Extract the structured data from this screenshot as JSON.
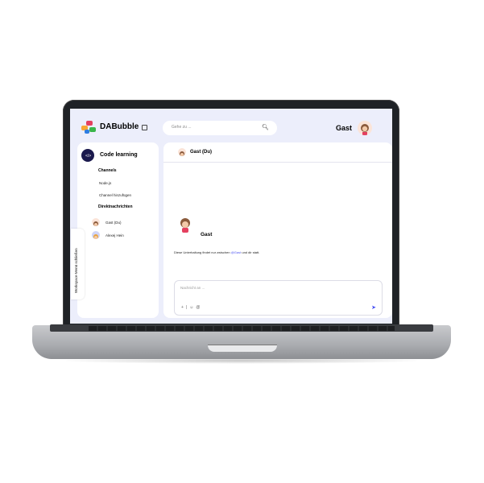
{
  "app": {
    "brand": "DABubble",
    "search_placeholder": "Gehe zu ...",
    "user_name": "Gast"
  },
  "sidebar": {
    "workspace_title": "Code learning",
    "channels_heading": "Channels",
    "channels": [
      "Node.js",
      "Channel hinzufügen"
    ],
    "dm_heading": "Direktnachrichten",
    "dms": [
      "Gast (Du)",
      "Alexej Hein"
    ],
    "toggle_label": "Workspace-Menü schließen"
  },
  "chat": {
    "title": "Gast (Du)",
    "profile_name": "Gast",
    "intro_before": "Diese Unterhaltung findet nur zwischen ",
    "intro_mention": "@Gast",
    "intro_after": " und dir statt.",
    "composer_placeholder": "Nachricht an ..."
  },
  "icons": {
    "logo": "dabubble-logo",
    "workspace": "workspace-edit-icon",
    "search": "search-icon",
    "send": "send-icon",
    "composer_tools": [
      "add-icon",
      "emoji-icon",
      "mention-icon"
    ]
  },
  "colors": {
    "accent": "#444df2",
    "background": "#eceefb",
    "workspace_avatar": "#1b1a4d"
  }
}
